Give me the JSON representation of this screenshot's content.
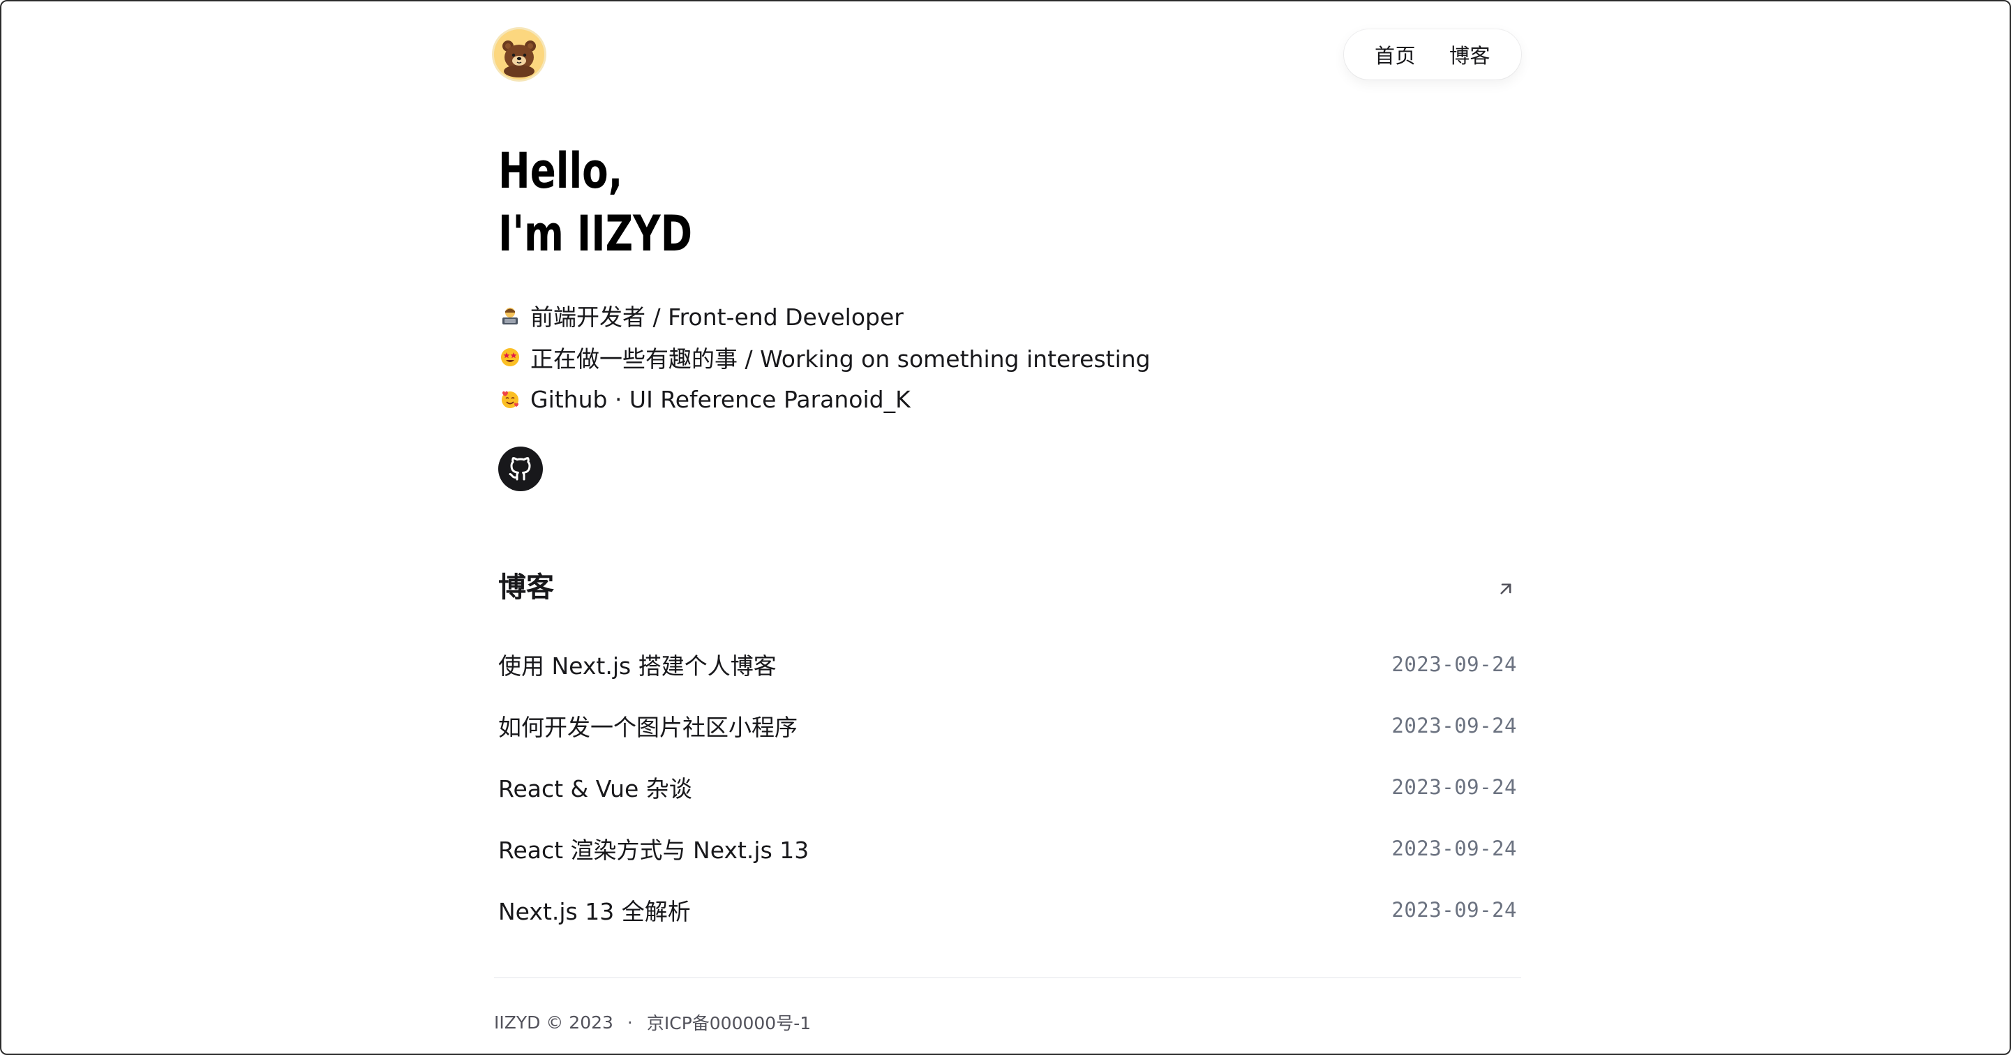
{
  "header": {
    "avatar_icon": "bear-avatar-icon",
    "nav": [
      {
        "label": "首页"
      },
      {
        "label": "博客"
      }
    ]
  },
  "hero": {
    "title_line1": "Hello,",
    "title_line2": "I'm IIZYD"
  },
  "intro": [
    {
      "icon": "technologist-emoji-icon",
      "text": "前端开发者 / Front-end Developer"
    },
    {
      "icon": "star-struck-emoji-icon",
      "text": "正在做一些有趣的事 / Working on something interesting"
    },
    {
      "icon": "smiling-hearts-emoji-icon",
      "text": "Github · UI Reference Paranoid_K"
    }
  ],
  "social": {
    "github_icon": "github-icon"
  },
  "blog": {
    "title": "博客",
    "arrow_icon": "arrow-up-right-icon",
    "posts": [
      {
        "title": "使用 Next.js 搭建个人博客",
        "date": "2023-09-24"
      },
      {
        "title": "如何开发一个图片社区小程序",
        "date": "2023-09-24"
      },
      {
        "title": "React & Vue 杂谈",
        "date": "2023-09-24"
      },
      {
        "title": "React 渲染方式与 Next.js 13",
        "date": "2023-09-24"
      },
      {
        "title": "Next.js 13 全解析",
        "date": "2023-09-24"
      }
    ]
  },
  "footer": {
    "copyright": "IIZYD © 2023",
    "separator": "·",
    "icp": "京ICP备000000号-1"
  },
  "colors": {
    "text": "#18181b",
    "muted": "#6b7280",
    "avatar_bg": "#fcd77f"
  }
}
